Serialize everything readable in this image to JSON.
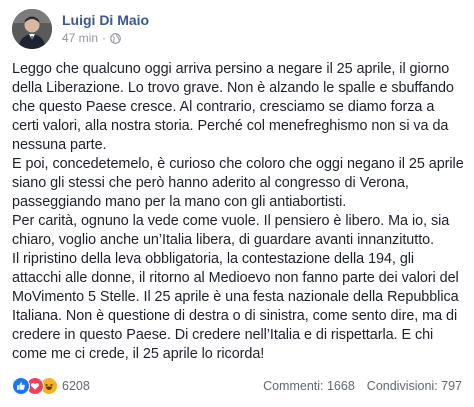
{
  "post": {
    "author": "Luigi Di Maio",
    "time": "47 min",
    "separator": "·",
    "body": [
      "Leggo che qualcuno oggi arriva persino a negare il 25 aprile, il giorno della Liberazione. Lo trovo grave. Non è alzando le spalle e sbuffando che questo Paese cresce. Al contrario, cresciamo se diamo forza a certi valori, alla nostra storia. Perché col menefreghismo non si va da nessuna parte.",
      "E poi, concedetemelo, è curioso che coloro che oggi negano il 25 aprile siano gli stessi che però hanno aderito al congresso di Verona, passeggiando mano per la mano con gli antiabortisti.",
      "Per carità, ognuno la vede come vuole. Il pensiero è libero. Ma io, sia chiaro, voglio anche un’Italia libera, di guardare avanti innanzitutto.",
      "Il ripristino della leva obbligatoria, la contestazione della 194, gli attacchi alle donne, il ritorno al Medioevo non fanno parte dei valori del MoVimento 5 Stelle. Il 25 aprile è una festa nazionale della Repubblica Italiana. Non è questione di destra o di sinistra, come sento dire, ma di credere in questo Paese. Di credere nell’Italia e di rispettarla. E chi come me ci crede, il 25 aprile lo ricorda!"
    ]
  },
  "footer": {
    "reaction_count": "6208",
    "comments": "Commenti: 1668",
    "shares": "Condivisioni: 797"
  },
  "icons": {
    "reactions": [
      "like-icon",
      "love-icon",
      "haha-icon"
    ],
    "privacy": "globe-icon"
  },
  "colors": {
    "author": "#385898",
    "like": "#1877f2",
    "love": "#f33e58",
    "haha": "#f7b125"
  }
}
